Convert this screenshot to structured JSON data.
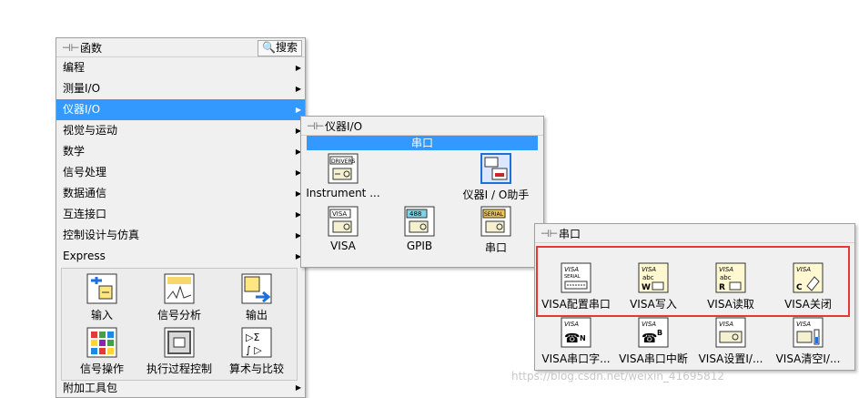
{
  "functions_palette": {
    "title": "函数",
    "search_label": "搜索",
    "menu_items": [
      {
        "label": "编程"
      },
      {
        "label": "测量I/O"
      },
      {
        "label": "仪器I/O",
        "selected": true
      },
      {
        "label": "视觉与运动"
      },
      {
        "label": "数学"
      },
      {
        "label": "信号处理"
      },
      {
        "label": "数据通信"
      },
      {
        "label": "互连接口"
      },
      {
        "label": "控制设计与仿真"
      },
      {
        "label": "Express"
      }
    ],
    "express_items": [
      {
        "label": "输入",
        "icon": "input-icon"
      },
      {
        "label": "信号分析",
        "icon": "signal-analysis-icon"
      },
      {
        "label": "输出",
        "icon": "output-icon"
      },
      {
        "label": "信号操作",
        "icon": "signal-manipulation-icon"
      },
      {
        "label": "执行过程控制",
        "icon": "execution-control-icon"
      },
      {
        "label": "算术与比较",
        "icon": "arithmetic-comparison-icon"
      }
    ],
    "addon_label": "附加工具包"
  },
  "instrument_palette": {
    "title": "仪器I/O",
    "section_header": "串口",
    "items": [
      {
        "label": "Instrument ...",
        "icon": "instrument-drivers-icon"
      },
      {
        "label": "仪器I / O助手",
        "icon": "instrument-io-assistant-icon"
      },
      {
        "label": "VISA",
        "icon": "visa-icon"
      },
      {
        "label": "GPIB",
        "icon": "gpib-icon"
      },
      {
        "label": "串口",
        "icon": "serial-icon"
      }
    ]
  },
  "serial_palette": {
    "title": "串口",
    "items": [
      {
        "label": "VISA配置串口",
        "icon": "visa-configure-serial-icon"
      },
      {
        "label": "VISA写入",
        "icon": "visa-write-icon"
      },
      {
        "label": "VISA读取",
        "icon": "visa-read-icon"
      },
      {
        "label": "VISA关闭",
        "icon": "visa-close-icon"
      },
      {
        "label": "VISA串口字...",
        "icon": "visa-serial-break-icon"
      },
      {
        "label": "VISA串口中断",
        "icon": "visa-serial-interrupt-icon"
      },
      {
        "label": "VISA设置I/...",
        "icon": "visa-set-buffer-icon"
      },
      {
        "label": "VISA清空I/...",
        "icon": "visa-flush-buffer-icon"
      }
    ]
  },
  "watermark": "https://blog.csdn.net/weixin_41695812"
}
